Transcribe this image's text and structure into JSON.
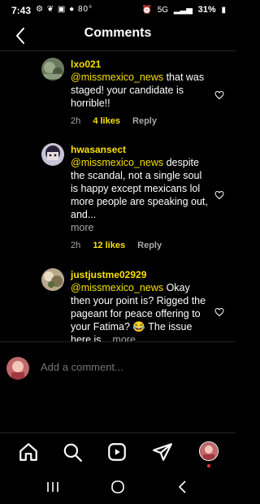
{
  "status": {
    "time": "7:43",
    "temp": "80°",
    "network": "5G",
    "battery": "31%"
  },
  "header": {
    "title": "Comments"
  },
  "comments": [
    {
      "username": "lxo021",
      "mention": "@missmexico_news",
      "text": " that was staged! your candidate is horrible!!",
      "time": "2h",
      "likes": "4 likes",
      "reply": "Reply"
    },
    {
      "username": "hwasansect",
      "mention": "@missmexico_news",
      "text": " despite the scandal, not a single soul is happy except mexicans lol more people are speaking out, and...",
      "more": "more",
      "time": "2h",
      "likes": "12 likes",
      "reply": "Reply"
    },
    {
      "username": "justjustme02929",
      "mention": "@missmexico_news",
      "text": " Okay then your point is? Rigged the pageant for peace offering to your Fatima? 😂 The issue here is...",
      "more": "more"
    }
  ],
  "composer": {
    "placeholder": "Add a comment..."
  },
  "tabs": [
    "home-icon",
    "search-icon",
    "reels-icon",
    "send-icon",
    "profile-avatar"
  ],
  "nav": [
    "recents-icon",
    "home-circle-icon",
    "back-icon"
  ],
  "colors": {
    "accent": "#f7e000",
    "background": "#000000",
    "muted": "#a8a8a8"
  }
}
